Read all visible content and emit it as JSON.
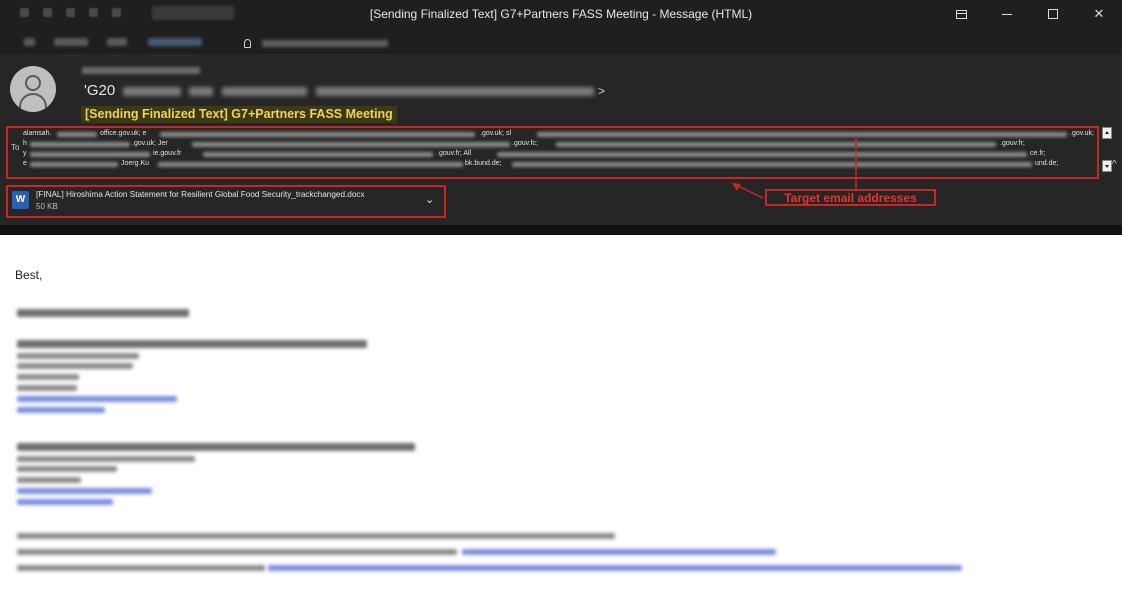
{
  "window": {
    "title": "[Sending Finalized Text] G7+Partners FASS Meeting  -  Message (HTML)",
    "menu": {
      "file": "File",
      "message": "Message",
      "help": "Help"
    },
    "controls": {
      "ribbon": "ribbon-display-icon",
      "minimize": "minimize-icon",
      "maximize": "maximize-icon",
      "close": "✕"
    }
  },
  "message": {
    "sender_prefix": "'G20",
    "sender_suffix": ">",
    "subject": "[Sending Finalized Text] G7+Partners FASS Meeting",
    "to_label": "To",
    "to_fragments": [
      {
        "line": 1,
        "items": [
          "alamsah.",
          "office.gov.uk; e",
          ".gov.uk; sl",
          ".gov.uk;"
        ]
      },
      {
        "line": 2,
        "items": [
          "h",
          ".gov.uk; Jer",
          ".gouv.fc;",
          ".gouv.fr;"
        ]
      },
      {
        "line": 3,
        "items": [
          "y",
          "ie.gouv.fr",
          ".gouv.fr; All",
          "ce.fr;"
        ]
      },
      {
        "line": 4,
        "items": [
          "e",
          "Joerg.Ku",
          "bk.bund.de;",
          "und.de;"
        ]
      }
    ]
  },
  "attachment": {
    "name": "[FINAL] Hiroshima Action Statement for Resilient Global Food Security_trackchanged.docx",
    "size": "50 KB",
    "icon_letter": "W"
  },
  "annotation": {
    "label": "Target email addresses",
    "color": "#c62828"
  },
  "body": {
    "greeting": "Best,"
  },
  "colors": {
    "subject_text": "#f2d35a",
    "subject_bg": "#3b3a14",
    "header_bg": "#262626",
    "titlebar_bg": "#1f1f1f"
  }
}
